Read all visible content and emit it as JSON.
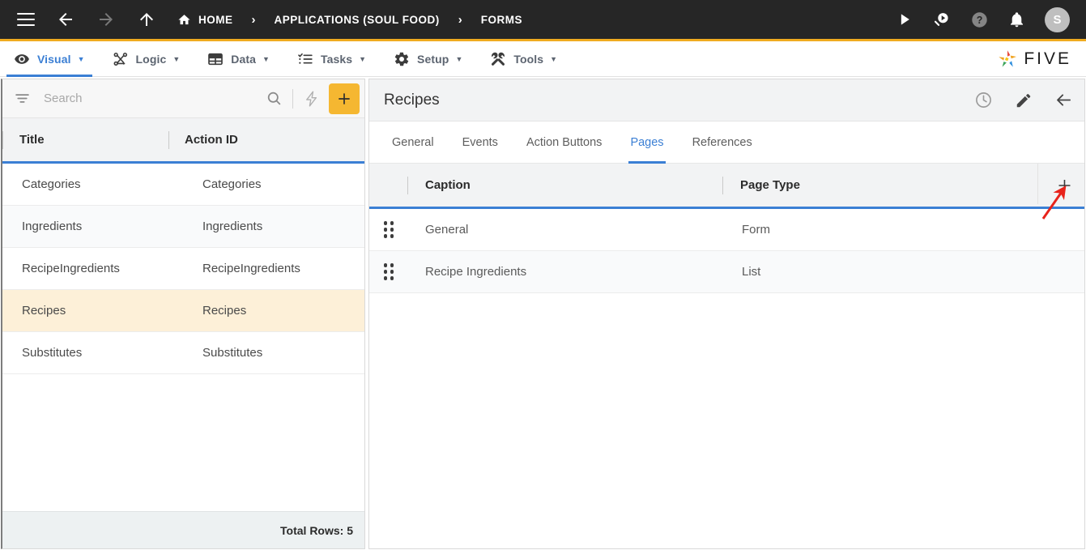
{
  "topbar": {
    "menu_icon": "hamburger-icon",
    "back_icon": "arrow-left-icon",
    "forward_icon": "arrow-right-icon",
    "up_icon": "arrow-up-icon",
    "breadcrumbs": [
      {
        "label": "HOME",
        "icon": "home-icon"
      },
      {
        "label": "APPLICATIONS (SOUL FOOD)",
        "icon": ""
      },
      {
        "label": "FORMS",
        "icon": ""
      }
    ],
    "separator": "›",
    "actions": [
      {
        "name": "run-icon",
        "title": "Run"
      },
      {
        "name": "search-run-icon",
        "title": "Search"
      },
      {
        "name": "help-icon",
        "title": "Help"
      },
      {
        "name": "notifications-bell-icon",
        "title": "Notifications"
      }
    ],
    "avatar_initial": "S",
    "background": "#262626",
    "accent_rule": "#f0ab20"
  },
  "menubar": {
    "items": [
      {
        "label": "Visual",
        "icon": "eye-icon",
        "caret": "▼",
        "active": true
      },
      {
        "label": "Logic",
        "icon": "logic-nodes-icon",
        "caret": "▼",
        "active": false
      },
      {
        "label": "Data",
        "icon": "table-grid-icon",
        "caret": "▼",
        "active": false
      },
      {
        "label": "Tasks",
        "icon": "checklist-icon",
        "caret": "▼",
        "active": false
      },
      {
        "label": "Setup",
        "icon": "gear-icon",
        "caret": "▼",
        "active": false
      },
      {
        "label": "Tools",
        "icon": "tools-icon",
        "caret": "▼",
        "active": false
      }
    ],
    "brand": "FIVE",
    "active_color": "#3b7fd4"
  },
  "left_panel": {
    "search": {
      "placeholder": "Search",
      "value": "",
      "filter_icon": "filter-icon",
      "search_icon": "search-icon",
      "lightning_icon": "lightning-bolt-icon"
    },
    "add_button": {
      "label": "+",
      "color": "#f5b731",
      "icon": "plus-icon"
    },
    "columns": [
      "Title",
      "Action ID"
    ],
    "rows": [
      {
        "title": "Categories",
        "action_id": "Categories",
        "selected": false
      },
      {
        "title": "Ingredients",
        "action_id": "Ingredients",
        "selected": false
      },
      {
        "title": "RecipeIngredients",
        "action_id": "RecipeIngredients",
        "selected": false
      },
      {
        "title": "Recipes",
        "action_id": "Recipes",
        "selected": true
      },
      {
        "title": "Substitutes",
        "action_id": "Substitutes",
        "selected": false
      }
    ],
    "footer": "Total Rows: 5",
    "selected_row_color": "#fdf0d8"
  },
  "right_panel": {
    "title": "Recipes",
    "header_icons": [
      {
        "name": "history-clock-icon"
      },
      {
        "name": "edit-pencil-icon"
      },
      {
        "name": "back-arrow-icon"
      }
    ],
    "tabs": [
      {
        "label": "General",
        "active": false
      },
      {
        "label": "Events",
        "active": false
      },
      {
        "label": "Action Buttons",
        "active": false
      },
      {
        "label": "Pages",
        "active": true
      },
      {
        "label": "References",
        "active": false
      }
    ],
    "table": {
      "columns": [
        "Caption",
        "Page Type"
      ],
      "add_icon": "plus-icon",
      "rows": [
        {
          "caption": "General",
          "page_type": "Form"
        },
        {
          "caption": "Recipe Ingredients",
          "page_type": "List"
        }
      ]
    }
  },
  "annotation": {
    "type": "arrow",
    "color": "#e8231b",
    "points_to": "add-page-button"
  }
}
